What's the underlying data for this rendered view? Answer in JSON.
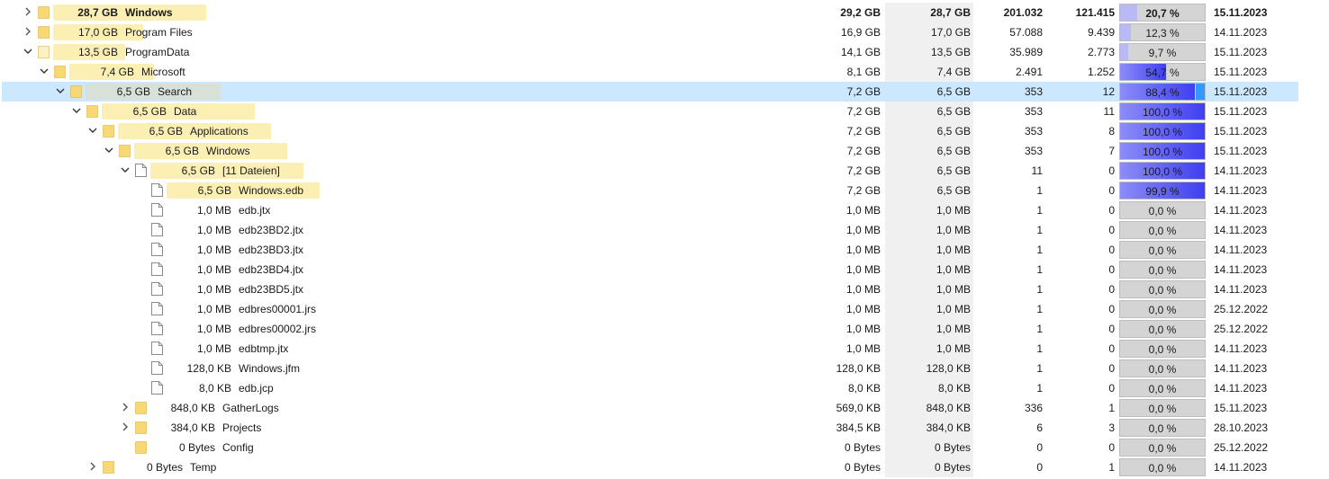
{
  "colors": {
    "folder": "#f8d775",
    "size_bar": "#fcefb4",
    "selected_row": "#cce8ff",
    "percent_bar": "#3f3ff0",
    "percent_track": "#d4d4d4"
  },
  "rows": [
    {
      "depth": 0,
      "expander": "collapsed",
      "icon": "folder",
      "size": "28,7 GB",
      "name": "Windows",
      "alloc": "29,2 GB",
      "size_col": "28,7 GB",
      "files": "201.032",
      "folders": "121.415",
      "percent": "20,7 %",
      "pct_value": 20.7,
      "date": "15.11.2023",
      "bold": true,
      "bar_frac": 1.0
    },
    {
      "depth": 0,
      "expander": "collapsed",
      "icon": "folder",
      "size": "17,0 GB",
      "name": "Program Files",
      "alloc": "16,9 GB",
      "size_col": "17,0 GB",
      "files": "57.088",
      "folders": "9.439",
      "percent": "12,3 %",
      "pct_value": 12.3,
      "date": "14.11.2023",
      "bar_frac": 0.59
    },
    {
      "depth": 0,
      "expander": "expanded",
      "icon": "folder-light",
      "size": "13,5 GB",
      "name": "ProgramData",
      "alloc": "14,1 GB",
      "size_col": "13,5 GB",
      "files": "35.989",
      "folders": "2.773",
      "percent": "9,7 %",
      "pct_value": 9.7,
      "date": "15.11.2023",
      "bar_frac": 0.47
    },
    {
      "depth": 1,
      "expander": "expanded",
      "icon": "folder",
      "size": "7,4 GB",
      "name": "Microsoft",
      "alloc": "8,1 GB",
      "size_col": "7,4 GB",
      "files": "2.491",
      "folders": "1.252",
      "percent": "54,7 %",
      "pct_value": 54.7,
      "date": "15.11.2023",
      "bar_frac": 0.55
    },
    {
      "depth": 2,
      "expander": "expanded",
      "icon": "folder",
      "size": "6,5 GB",
      "name": "Search",
      "alloc": "7,2 GB",
      "size_col": "6,5 GB",
      "files": "353",
      "folders": "12",
      "percent": "88,4 %",
      "pct_value": 88.4,
      "date": "15.11.2023",
      "selected": true,
      "bar_frac": 0.88
    },
    {
      "depth": 3,
      "expander": "expanded",
      "icon": "folder",
      "size": "6,5 GB",
      "name": "Data",
      "alloc": "7,2 GB",
      "size_col": "6,5 GB",
      "files": "353",
      "folders": "11",
      "percent": "100,0 %",
      "pct_value": 100.0,
      "date": "15.11.2023",
      "bar_frac": 1.0
    },
    {
      "depth": 4,
      "expander": "expanded",
      "icon": "folder",
      "size": "6,5 GB",
      "name": "Applications",
      "alloc": "7,2 GB",
      "size_col": "6,5 GB",
      "files": "353",
      "folders": "8",
      "percent": "100,0 %",
      "pct_value": 100.0,
      "date": "15.11.2023",
      "bar_frac": 1.0
    },
    {
      "depth": 5,
      "expander": "expanded",
      "icon": "folder",
      "size": "6,5 GB",
      "name": "Windows",
      "alloc": "7,2 GB",
      "size_col": "6,5 GB",
      "files": "353",
      "folders": "7",
      "percent": "100,0 %",
      "pct_value": 100.0,
      "date": "15.11.2023",
      "bar_frac": 1.0
    },
    {
      "depth": 6,
      "expander": "expanded",
      "icon": "file",
      "size": "6,5 GB",
      "name": "[11 Dateien]",
      "alloc": "7,2 GB",
      "size_col": "6,5 GB",
      "files": "11",
      "folders": "0",
      "percent": "100,0 %",
      "pct_value": 100.0,
      "date": "14.11.2023",
      "bar_frac": 1.0
    },
    {
      "depth": 7,
      "expander": "none",
      "icon": "file",
      "size": "6,5 GB",
      "name": "Windows.edb",
      "alloc": "7,2 GB",
      "size_col": "6,5 GB",
      "files": "1",
      "folders": "0",
      "percent": "99,9 %",
      "pct_value": 99.9,
      "date": "14.11.2023",
      "bar_frac": 1.0
    },
    {
      "depth": 7,
      "expander": "none",
      "icon": "file",
      "size": "1,0 MB",
      "name": "edb.jtx",
      "alloc": "1,0 MB",
      "size_col": "1,0 MB",
      "files": "1",
      "folders": "0",
      "percent": "0,0 %",
      "pct_value": 0,
      "date": "14.11.2023",
      "bar_frac": 0
    },
    {
      "depth": 7,
      "expander": "none",
      "icon": "file",
      "size": "1,0 MB",
      "name": "edb23BD2.jtx",
      "alloc": "1,0 MB",
      "size_col": "1,0 MB",
      "files": "1",
      "folders": "0",
      "percent": "0,0 %",
      "pct_value": 0,
      "date": "14.11.2023",
      "bar_frac": 0
    },
    {
      "depth": 7,
      "expander": "none",
      "icon": "file",
      "size": "1,0 MB",
      "name": "edb23BD3.jtx",
      "alloc": "1,0 MB",
      "size_col": "1,0 MB",
      "files": "1",
      "folders": "0",
      "percent": "0,0 %",
      "pct_value": 0,
      "date": "14.11.2023",
      "bar_frac": 0
    },
    {
      "depth": 7,
      "expander": "none",
      "icon": "file",
      "size": "1,0 MB",
      "name": "edb23BD4.jtx",
      "alloc": "1,0 MB",
      "size_col": "1,0 MB",
      "files": "1",
      "folders": "0",
      "percent": "0,0 %",
      "pct_value": 0,
      "date": "14.11.2023",
      "bar_frac": 0
    },
    {
      "depth": 7,
      "expander": "none",
      "icon": "file",
      "size": "1,0 MB",
      "name": "edb23BD5.jtx",
      "alloc": "1,0 MB",
      "size_col": "1,0 MB",
      "files": "1",
      "folders": "0",
      "percent": "0,0 %",
      "pct_value": 0,
      "date": "14.11.2023",
      "bar_frac": 0
    },
    {
      "depth": 7,
      "expander": "none",
      "icon": "file",
      "size": "1,0 MB",
      "name": "edbres00001.jrs",
      "alloc": "1,0 MB",
      "size_col": "1,0 MB",
      "files": "1",
      "folders": "0",
      "percent": "0,0 %",
      "pct_value": 0,
      "date": "25.12.2022",
      "bar_frac": 0
    },
    {
      "depth": 7,
      "expander": "none",
      "icon": "file",
      "size": "1,0 MB",
      "name": "edbres00002.jrs",
      "alloc": "1,0 MB",
      "size_col": "1,0 MB",
      "files": "1",
      "folders": "0",
      "percent": "0,0 %",
      "pct_value": 0,
      "date": "25.12.2022",
      "bar_frac": 0
    },
    {
      "depth": 7,
      "expander": "none",
      "icon": "file",
      "size": "1,0 MB",
      "name": "edbtmp.jtx",
      "alloc": "1,0 MB",
      "size_col": "1,0 MB",
      "files": "1",
      "folders": "0",
      "percent": "0,0 %",
      "pct_value": 0,
      "date": "14.11.2023",
      "bar_frac": 0
    },
    {
      "depth": 7,
      "expander": "none",
      "icon": "file",
      "size": "128,0 KB",
      "name": "Windows.jfm",
      "alloc": "128,0 KB",
      "size_col": "128,0 KB",
      "files": "1",
      "folders": "0",
      "percent": "0,0 %",
      "pct_value": 0,
      "date": "14.11.2023",
      "bar_frac": 0
    },
    {
      "depth": 7,
      "expander": "none",
      "icon": "file",
      "size": "8,0 KB",
      "name": "edb.jcp",
      "alloc": "8,0 KB",
      "size_col": "8,0 KB",
      "files": "1",
      "folders": "0",
      "percent": "0,0 %",
      "pct_value": 0,
      "date": "14.11.2023",
      "bar_frac": 0
    },
    {
      "depth": 6,
      "expander": "collapsed",
      "icon": "folder",
      "size": "848,0 KB",
      "name": "GatherLogs",
      "alloc": "569,0 KB",
      "size_col": "848,0 KB",
      "files": "336",
      "folders": "1",
      "percent": "0,0 %",
      "pct_value": 0,
      "date": "15.11.2023",
      "bar_frac": 0
    },
    {
      "depth": 6,
      "expander": "collapsed",
      "icon": "folder",
      "size": "384,0 KB",
      "name": "Projects",
      "alloc": "384,5 KB",
      "size_col": "384,0 KB",
      "files": "6",
      "folders": "3",
      "percent": "0,0 %",
      "pct_value": 0,
      "date": "28.10.2023",
      "bar_frac": 0
    },
    {
      "depth": 6,
      "expander": "none",
      "icon": "folder",
      "size": "0 Bytes",
      "name": "Config",
      "alloc": "0 Bytes",
      "size_col": "0 Bytes",
      "files": "0",
      "folders": "0",
      "percent": "0,0 %",
      "pct_value": 0,
      "date": "25.12.2022",
      "bar_frac": 0
    },
    {
      "depth": 4,
      "expander": "collapsed",
      "icon": "folder",
      "size": "0 Bytes",
      "name": "Temp",
      "alloc": "0 Bytes",
      "size_col": "0 Bytes",
      "files": "0",
      "folders": "1",
      "percent": "0,0 %",
      "pct_value": 0,
      "date": "14.11.2023",
      "bar_frac": 0
    }
  ]
}
